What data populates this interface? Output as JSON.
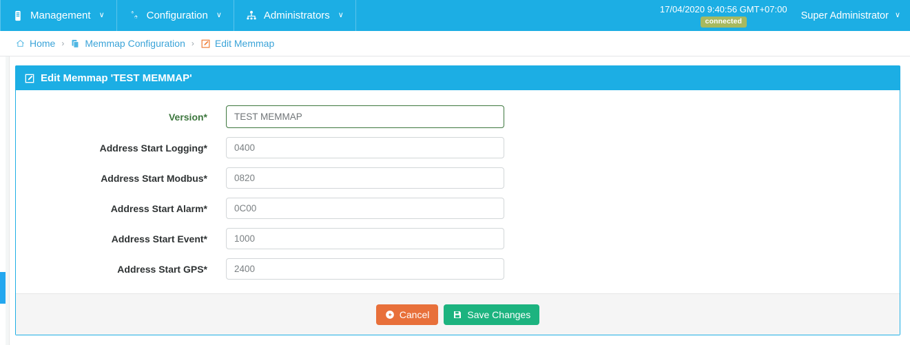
{
  "navbar": {
    "menus": [
      {
        "label": "Management",
        "icon": "device-icon",
        "caret": "∨"
      },
      {
        "label": "Configuration",
        "icon": "cogs-icon",
        "caret": "∨"
      },
      {
        "label": "Administrators",
        "icon": "sitemap-users-icon",
        "caret": "∨"
      }
    ],
    "clock": "17/04/2020 9:40:56 GMT+07:00",
    "status_badge": "connected",
    "user": "Super Administrator",
    "user_caret": "∨",
    "bg_color": "#1caee4",
    "badge_color": "#a7b95f"
  },
  "breadcrumb": {
    "separator": "›",
    "items": [
      {
        "label": "Home",
        "icon": "home-icon"
      },
      {
        "label": "Memmap Configuration",
        "icon": "copy-icon"
      },
      {
        "label": "Edit Memmap",
        "icon": "edit-square-icon"
      }
    ]
  },
  "panel": {
    "title": "Edit Memmap 'TEST MEMMAP'",
    "title_icon": "edit-square-icon",
    "header_color": "#1caee4",
    "fields": [
      {
        "label": "Version*",
        "value": "TEST MEMMAP",
        "state": "valid"
      },
      {
        "label": "Address Start Logging*",
        "value": "0400",
        "state": "normal"
      },
      {
        "label": "Address Start Modbus*",
        "value": "0820",
        "state": "normal"
      },
      {
        "label": "Address Start Alarm*",
        "value": "0C00",
        "state": "normal"
      },
      {
        "label": "Address Start Event*",
        "value": "1000",
        "state": "normal"
      },
      {
        "label": "Address Start GPS*",
        "value": "2400",
        "state": "normal"
      }
    ],
    "buttons": {
      "cancel": {
        "label": "Cancel",
        "icon": "arrow-circle-left-icon",
        "color": "#e8703a"
      },
      "save": {
        "label": "Save Changes",
        "icon": "floppy-save-icon",
        "color": "#1cb37f"
      }
    }
  }
}
